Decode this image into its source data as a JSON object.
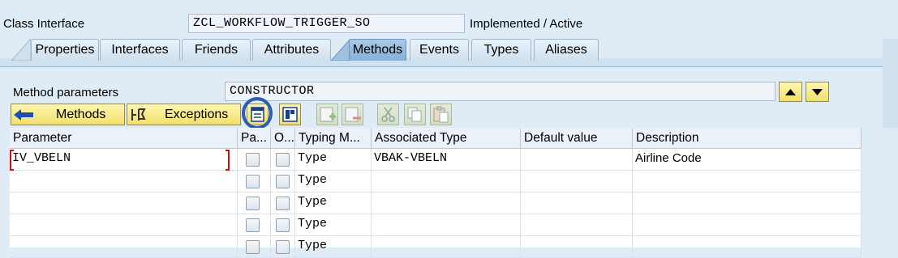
{
  "header": {
    "class_label": "Class Interface",
    "class_name": "ZCL_WORKFLOW_TRIGGER_SO",
    "status": "Implemented / Active"
  },
  "tabs": [
    "Properties",
    "Interfaces",
    "Friends",
    "Attributes",
    "Methods",
    "Events",
    "Types",
    "Aliases"
  ],
  "active_tab": "Methods",
  "method_params": {
    "label": "Method parameters",
    "value": "CONSTRUCTOR"
  },
  "toolbar": {
    "methods_label": "Methods",
    "exceptions_label": "Exceptions"
  },
  "table": {
    "columns": [
      "Parameter",
      "Pa...",
      "O...",
      "Typing M...",
      "Associated Type",
      "Default value",
      "Description"
    ],
    "rows": [
      {
        "parameter": "IV_VBELN",
        "typing": "Type",
        "assoc": "VBAK-VBELN",
        "default": "",
        "description": "Airline Code"
      },
      {
        "parameter": "",
        "typing": "Type",
        "assoc": "",
        "default": "",
        "description": ""
      },
      {
        "parameter": "",
        "typing": "Type",
        "assoc": "",
        "default": "",
        "description": ""
      },
      {
        "parameter": "",
        "typing": "Type",
        "assoc": "",
        "default": "",
        "description": ""
      },
      {
        "parameter": "",
        "typing": "Type",
        "assoc": "",
        "default": "",
        "description": ""
      }
    ]
  },
  "colors": {
    "background": "#dfebf5",
    "button_yellow": "#f2e06a",
    "active_tab": "#86b0d6",
    "highlight_circle": "#2a5cb8",
    "cursor_red": "#d01010"
  }
}
